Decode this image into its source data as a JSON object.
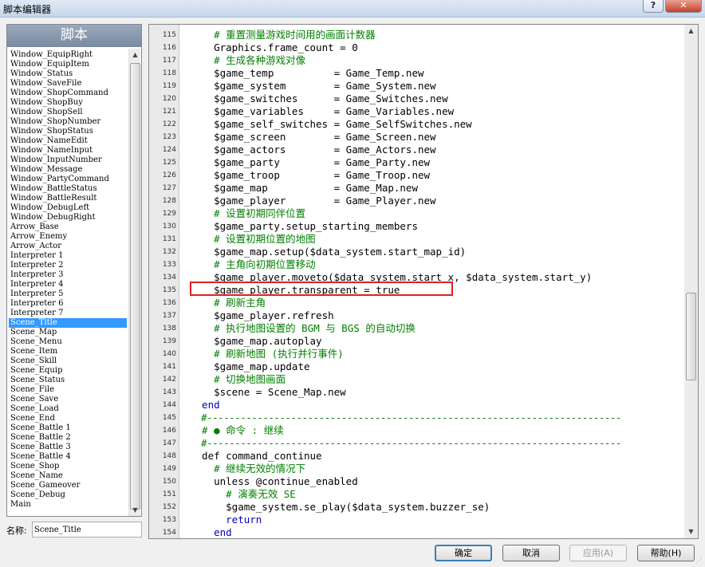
{
  "window": {
    "title": "脚本编辑器",
    "help_label": "?",
    "close_label": "✕"
  },
  "left": {
    "header": "脚本",
    "items": [
      "Window_EquipRight",
      "Window_EquipItem",
      "Window_Status",
      "Window_SaveFile",
      "Window_ShopCommand",
      "Window_ShopBuy",
      "Window_ShopSell",
      "Window_ShopNumber",
      "Window_ShopStatus",
      "Window_NameEdit",
      "Window_NameInput",
      "Window_InputNumber",
      "Window_Message",
      "Window_PartyCommand",
      "Window_BattleStatus",
      "Window_BattleResult",
      "Window_DebugLeft",
      "Window_DebugRight",
      "Arrow_Base",
      "Arrow_Enemy",
      "Arrow_Actor",
      "Interpreter 1",
      "Interpreter 2",
      "Interpreter 3",
      "Interpreter 4",
      "Interpreter 5",
      "Interpreter 6",
      "Interpreter 7",
      "Scene_Title",
      "Scene_Map",
      "Scene_Menu",
      "Scene_Item",
      "Scene_Skill",
      "Scene_Equip",
      "Scene_Status",
      "Scene_File",
      "Scene_Save",
      "Scene_Load",
      "Scene_End",
      "Scene_Battle 1",
      "Scene_Battle 2",
      "Scene_Battle 3",
      "Scene_Battle 4",
      "Scene_Shop",
      "Scene_Name",
      "Scene_Gameover",
      "Scene_Debug",
      "Main"
    ],
    "selected_index": 28,
    "name_label": "名称:",
    "name_value": "Scene_Title"
  },
  "editor": {
    "highlighted_line": 135,
    "lines": [
      {
        "n": "115",
        "t": "    # 重置测量游戏时间用的画面计数器",
        "k": "comment"
      },
      {
        "n": "116",
        "t": "    Graphics.frame_count = 0",
        "k": ""
      },
      {
        "n": "117",
        "t": "    # 生成各种游戏对像",
        "k": "comment"
      },
      {
        "n": "118",
        "t": "    $game_temp          = Game_Temp.new",
        "k": ""
      },
      {
        "n": "119",
        "t": "    $game_system        = Game_System.new",
        "k": ""
      },
      {
        "n": "120",
        "t": "    $game_switches      = Game_Switches.new",
        "k": ""
      },
      {
        "n": "121",
        "t": "    $game_variables     = Game_Variables.new",
        "k": ""
      },
      {
        "n": "122",
        "t": "    $game_self_switches = Game_SelfSwitches.new",
        "k": ""
      },
      {
        "n": "123",
        "t": "    $game_screen        = Game_Screen.new",
        "k": ""
      },
      {
        "n": "124",
        "t": "    $game_actors        = Game_Actors.new",
        "k": ""
      },
      {
        "n": "125",
        "t": "    $game_party         = Game_Party.new",
        "k": ""
      },
      {
        "n": "126",
        "t": "    $game_troop         = Game_Troop.new",
        "k": ""
      },
      {
        "n": "127",
        "t": "    $game_map           = Game_Map.new",
        "k": ""
      },
      {
        "n": "128",
        "t": "    $game_player        = Game_Player.new",
        "k": ""
      },
      {
        "n": "129",
        "t": "    # 设置初期同伴位置",
        "k": "comment"
      },
      {
        "n": "130",
        "t": "    $game_party.setup_starting_members",
        "k": ""
      },
      {
        "n": "131",
        "t": "    # 设置初期位置的地图",
        "k": "comment"
      },
      {
        "n": "132",
        "t": "    $game_map.setup($data_system.start_map_id)",
        "k": ""
      },
      {
        "n": "133",
        "t": "    # 主角向初期位置移动",
        "k": "comment"
      },
      {
        "n": "134",
        "t": "    $game_player.moveto($data_system.start_x, $data_system.start_y)",
        "k": ""
      },
      {
        "n": "135",
        "t": "    $game_player.transparent = true",
        "k": ""
      },
      {
        "n": "136",
        "t": "    # 刷新主角",
        "k": "comment"
      },
      {
        "n": "137",
        "t": "    $game_player.refresh",
        "k": ""
      },
      {
        "n": "138",
        "t": "    # 执行地图设置的 BGM 与 BGS 的自动切换",
        "k": "comment"
      },
      {
        "n": "139",
        "t": "    $game_map.autoplay",
        "k": ""
      },
      {
        "n": "140",
        "t": "    # 刷新地图 (执行并行事件)",
        "k": "comment"
      },
      {
        "n": "141",
        "t": "    $game_map.update",
        "k": ""
      },
      {
        "n": "142",
        "t": "    # 切换地图画面",
        "k": "comment"
      },
      {
        "n": "143",
        "t": "    $scene = Scene_Map.new",
        "k": ""
      },
      {
        "n": "144",
        "t": "  end",
        "k": "kw"
      },
      {
        "n": "145",
        "t": "  #--------------------------------------------------------------------------",
        "k": "divider"
      },
      {
        "n": "146",
        "t": "  # ● 命令 : 继续",
        "k": "comment"
      },
      {
        "n": "147",
        "t": "  #--------------------------------------------------------------------------",
        "k": "divider"
      },
      {
        "n": "148",
        "t": "  def command_continue",
        "k": ""
      },
      {
        "n": "149",
        "t": "    # 继续无效的情况下",
        "k": "comment"
      },
      {
        "n": "150",
        "t": "    unless @continue_enabled",
        "k": ""
      },
      {
        "n": "151",
        "t": "      # 演奏无效 SE",
        "k": "comment"
      },
      {
        "n": "152",
        "t": "      $game_system.se_play($data_system.buzzer_se)",
        "k": ""
      },
      {
        "n": "153",
        "t": "      return",
        "k": "kw"
      },
      {
        "n": "154",
        "t": "    end",
        "k": "kw"
      }
    ]
  },
  "buttons": {
    "ok": "确定",
    "cancel": "取消",
    "apply": "应用(A)",
    "help": "帮助(H)"
  },
  "colors": {
    "comment": "#008000",
    "keyword": "#0000c0",
    "selection": "#3399ff",
    "highlight_box": "#e02020"
  }
}
